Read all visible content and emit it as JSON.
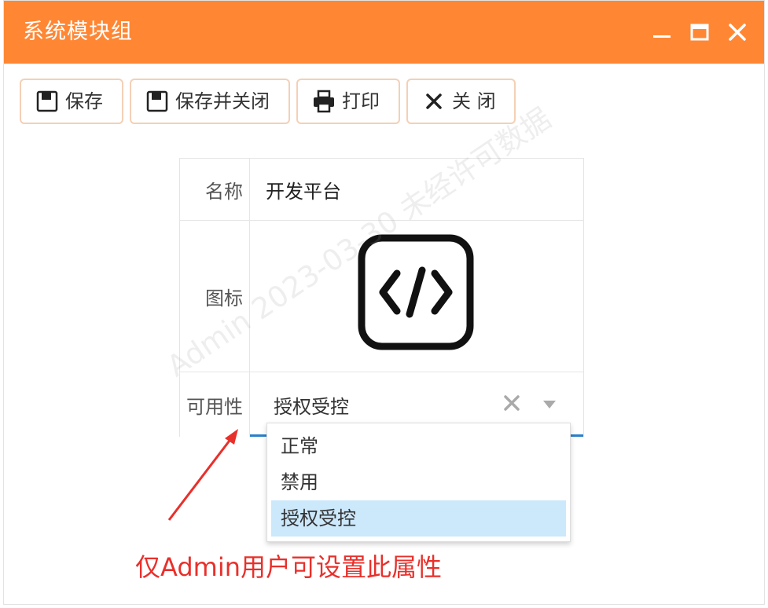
{
  "window": {
    "title": "系统模块组"
  },
  "toolbar": {
    "save": "保存",
    "save_close": "保存并关闭",
    "print": "打印",
    "close": "关 闭"
  },
  "form": {
    "name_label": "名称",
    "name_value": "开发平台",
    "icon_label": "图标",
    "icon": "code-square-icon",
    "availability_label": "可用性",
    "availability_value": "授权受控"
  },
  "dropdown": {
    "options": [
      "正常",
      "禁用",
      "授权受控"
    ],
    "selected": "授权受控"
  },
  "annotation": "仅Admin用户可设置此属性",
  "watermark": "Admin 2023-03-30 未经许可数据",
  "colors": {
    "titlebar": "#ff8734",
    "accent": "#2a80c9",
    "annotation": "#e8302b",
    "selected_option": "#cce8fb"
  }
}
